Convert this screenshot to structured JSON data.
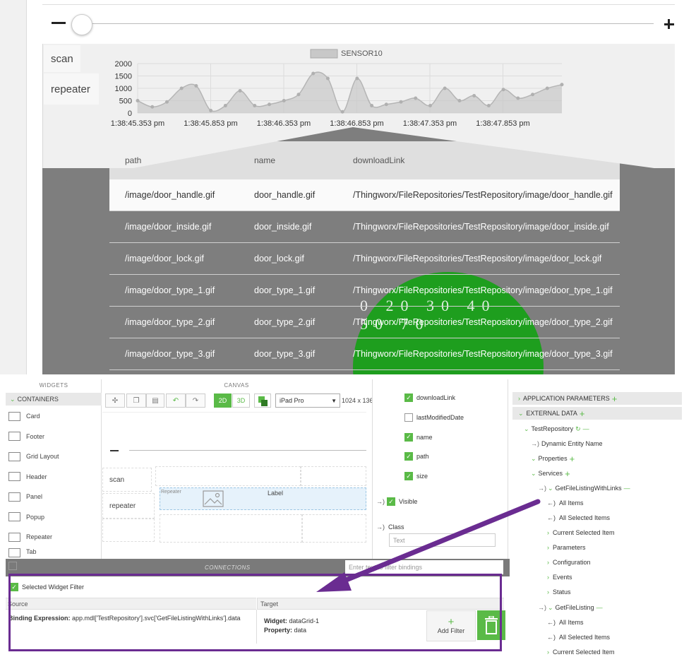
{
  "preview": {
    "tabs": [
      "scan",
      "repeater"
    ],
    "chart_data": {
      "type": "line",
      "title": "",
      "legend": "top-center",
      "series": [
        {
          "name": "SENSOR10",
          "values": [
            500,
            250,
            450,
            1000,
            1100,
            100,
            300,
            900,
            300,
            350,
            500,
            750,
            1600,
            1400,
            50,
            1400,
            300,
            350,
            450,
            600,
            300,
            1000,
            500,
            700,
            300,
            950,
            600,
            750,
            1000,
            1150
          ]
        }
      ],
      "y_ticks": [
        "2000",
        "1500",
        "1000",
        "500",
        "0"
      ],
      "x_ticks": [
        "1:38:45.353 pm",
        "1:38:45.853 pm",
        "1:38:46.353 pm",
        "1:38:46.853 pm",
        "1:38:47.353 pm",
        "1:38:47.853 pm"
      ],
      "ylim": [
        0,
        2000
      ],
      "grid": true,
      "color": "#c8c8c8"
    },
    "table": {
      "headers": [
        "path",
        "name",
        "downloadLink"
      ],
      "rows": [
        [
          "/image/door_handle.gif",
          "door_handle.gif",
          "/Thingworx/FileRepositories/TestRepository/image/door_handle.gif"
        ],
        [
          "/image/door_inside.gif",
          "door_inside.gif",
          "/Thingworx/FileRepositories/TestRepository/image/door_inside.gif"
        ],
        [
          "/image/door_lock.gif",
          "door_lock.gif",
          "/Thingworx/FileRepositories/TestRepository/image/door_lock.gif"
        ],
        [
          "/image/door_type_1.gif",
          "door_type_1.gif",
          "/Thingworx/FileRepositories/TestRepository/image/door_type_1.gif"
        ],
        [
          "/image/door_type_2.gif",
          "door_type_2.gif",
          "/Thingworx/FileRepositories/TestRepository/image/door_type_2.gif"
        ],
        [
          "/image/door_type_3.gif",
          "door_type_3.gif",
          "/Thingworx/FileRepositories/TestRepository/image/door_type_3.gif"
        ]
      ]
    },
    "gauge_labels": "0 20 30 40 50 70",
    "gauge_color": "#1e9e1e"
  },
  "widgets": {
    "title": "WIDGETS",
    "section": "CONTAINERS",
    "items": [
      "Card",
      "Footer",
      "Grid Layout",
      "Header",
      "Panel",
      "Popup",
      "Repeater",
      "Tab"
    ]
  },
  "canvas": {
    "title": "CANVAS",
    "mode_2d": "2D",
    "mode_3d": "3D",
    "device": "iPad Pro",
    "resolution": "1024 x 136",
    "scan_label": "scan",
    "repeater_label": "repeater",
    "repeater_widget_label": "Repeater",
    "label_widget_text": "Label"
  },
  "properties": {
    "fields": [
      {
        "label": "downloadLink",
        "checked": true
      },
      {
        "label": "lastModifiedDate",
        "checked": false
      },
      {
        "label": "name",
        "checked": true
      },
      {
        "label": "path",
        "checked": true
      },
      {
        "label": "size",
        "checked": true
      }
    ],
    "visible_label": "Visible",
    "class_label": "Class",
    "class_placeholder": "Text"
  },
  "data_panel": {
    "app_params": "APPLICATION PARAMETERS",
    "external_data": "EXTERNAL DATA",
    "repository": "TestRepository",
    "dynamic_entity": "Dynamic Entity Name",
    "properties": "Properties",
    "services": "Services",
    "service1": "GetFileListingWithLinks",
    "service1_items": [
      "All Items",
      "All Selected Items",
      "Current Selected Item",
      "Parameters",
      "Configuration",
      "Events",
      "Status"
    ],
    "service2": "GetFileListing",
    "service2_items": [
      "All Items",
      "All Selected Items",
      "Current Selected Item"
    ]
  },
  "connections": {
    "title": "CONNECTIONS",
    "filter_placeholder": "Enter text to filter bindings",
    "selected_widget_filter": "Selected Widget Filter",
    "source_header": "Source",
    "target_header": "Target",
    "binding_label": "Binding Expression:",
    "binding_value": "app.mdl['TestRepository'].svc['GetFileListingWithLinks'].data",
    "widget_label": "Widget:",
    "widget_value": "dataGrid-1",
    "property_label": "Property:",
    "property_value": "data",
    "add_filter": "Add Filter"
  },
  "accent_color": "#5aba47",
  "annotation_color": "#6a2c91"
}
